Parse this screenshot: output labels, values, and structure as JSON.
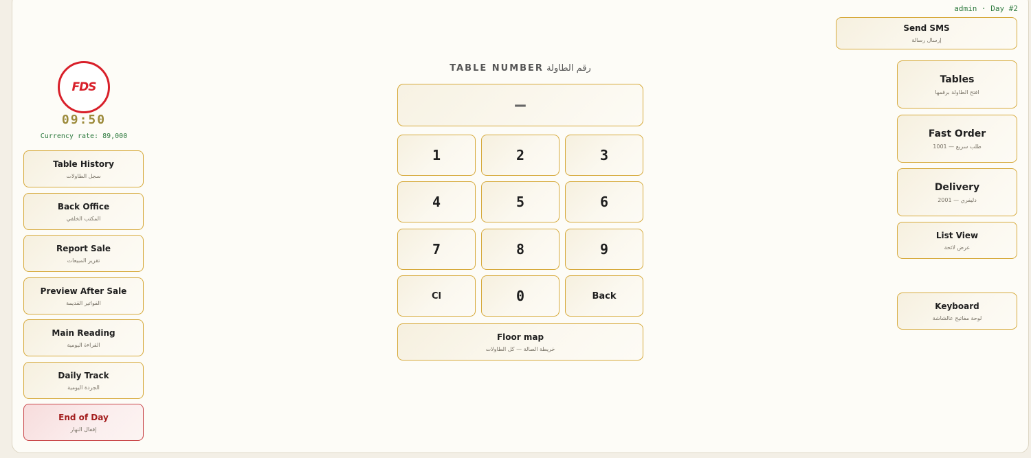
{
  "header": {
    "user_day": "admin · Day #2"
  },
  "brand": {
    "logo_text": "FDS",
    "clock": "09:50",
    "currency_rate": "Currency rate: 89,000"
  },
  "left_menu": [
    {
      "title": "Table History",
      "subtitle": "سجل الطاولات"
    },
    {
      "title": "Back Office",
      "subtitle": "المكتب الخلفي"
    },
    {
      "title": "Report Sale",
      "subtitle": "تقرير المبيعات"
    },
    {
      "title": "Preview After Sale",
      "subtitle": "الفواتير القديمة"
    },
    {
      "title": "Main Reading",
      "subtitle": "القراءة اليومية"
    },
    {
      "title": "Daily Track",
      "subtitle": "الجردة اليومية"
    },
    {
      "title": "End of Day",
      "subtitle": "إقفال النهار"
    }
  ],
  "table_number": {
    "label_en": "TABLE NUMBER",
    "label_ar": "رقم الطاولة",
    "value": "—"
  },
  "keypad": [
    "1",
    "2",
    "3",
    "4",
    "5",
    "6",
    "7",
    "8",
    "9",
    "Cl",
    "0",
    "Back"
  ],
  "floor_map": {
    "title": "Floor map",
    "subtitle": "خريطة الصالة — كل الطاولات"
  },
  "right_menu": {
    "send_sms": {
      "title": "Send SMS",
      "subtitle": "إرسال رسالة"
    },
    "tables": {
      "title": "Tables",
      "subtitle": "افتح الطاولة برقمها"
    },
    "fast_order": {
      "title": "Fast Order",
      "subtitle": "طلب سريع — 1001"
    },
    "delivery": {
      "title": "Delivery",
      "subtitle": "دليفري — 2001"
    },
    "list_view": {
      "title": "List View",
      "subtitle": "عرض لائحة"
    },
    "keyboard": {
      "title": "Keyboard",
      "subtitle": "لوحة مفاتيح عالشاشة"
    }
  },
  "colors": {
    "accent_border": "#d6a93a",
    "danger": "#c9474a",
    "logo_red": "#d8202a",
    "status_green": "#2e7a3f"
  }
}
